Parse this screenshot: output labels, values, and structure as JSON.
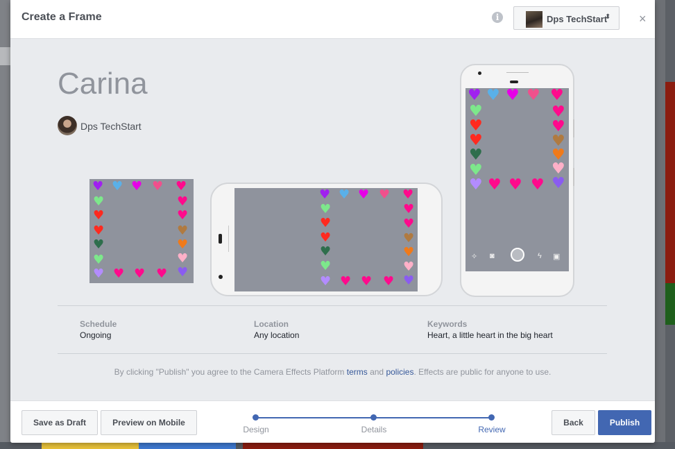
{
  "modal": {
    "title": "Create a Frame",
    "account_name": "Dps TechStart",
    "info_glyph": "i",
    "close_glyph": "×",
    "caret_glyph": "⬍"
  },
  "frame": {
    "name": "Carina",
    "creator": "Dps TechStart"
  },
  "details": {
    "schedule_label": "Schedule",
    "schedule_value": "Ongoing",
    "location_label": "Location",
    "location_value": "Any location",
    "keywords_label": "Keywords",
    "keywords_value": "Heart, a little heart in the big heart"
  },
  "legal": {
    "prefix": "By clicking \"Publish\" you agree to the Camera Effects Platform ",
    "terms": "terms",
    "and": " and ",
    "policies": "policies",
    "suffix": ". Effects are public for anyone to use."
  },
  "footer": {
    "save_draft": "Save as Draft",
    "preview_mobile": "Preview on Mobile",
    "back": "Back",
    "publish": "Publish",
    "steps": [
      "Design",
      "Details",
      "Review"
    ],
    "active_step": "Review"
  },
  "icons": {
    "info": "info-icon",
    "close": "close-icon",
    "heart": "heart-icon",
    "camera_controls": [
      "magic-wand-icon",
      "camera-icon",
      "shutter-button",
      "flash-icon",
      "gallery-icon"
    ]
  },
  "colors": {
    "primary": "#4267b2",
    "link": "#365899",
    "heart_purple": "#a020f0",
    "heart_blue": "#5ab0e8",
    "heart_magenta": "#e600e6",
    "heart_pink": "#ff0a8c",
    "heart_red": "#ff2a1f",
    "heart_green": "#7de88b",
    "heart_darkgreen": "#2e6e4c",
    "heart_brown": "#b07a40",
    "heart_orange": "#f07a1a",
    "heart_lightpink": "#ffb0c8",
    "heart_lavender": "#b38cff"
  }
}
